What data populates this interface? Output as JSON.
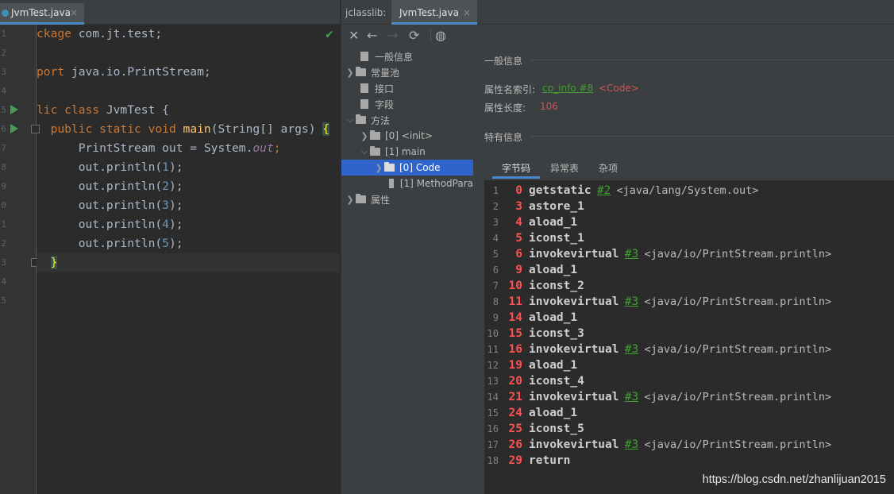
{
  "editor": {
    "tab": {
      "name": "JvmTest.java",
      "close": "×"
    },
    "line_numbers": [
      "1",
      "2",
      "3",
      "4",
      "5",
      "6",
      "7",
      "8",
      "9",
      "0",
      "1",
      "2",
      "3",
      "4",
      "5"
    ],
    "code": {
      "l1_a": "ckage",
      "l1_b": " com.jt.test;",
      "l3_a": "port",
      "l3_b": " java.io.PrintStream;",
      "l5_a": "lic",
      "l5_b": " class",
      "l5_c": " JvmTest {",
      "l6_indent": "  ",
      "l6_a": "public static void",
      "l6_b": " ",
      "l6_c": "main",
      "l6_d": "(String[] args) ",
      "l6_e": "{",
      "l7_a": "      PrintStream out = System.",
      "l7_b": "out",
      "l7_c": ";",
      "l8_a": "      out.println(",
      "l8_n": "1",
      "l8_c": ");",
      "l9_a": "      out.println(",
      "l9_n": "2",
      "l9_c": ");",
      "l10_a": "      out.println(",
      "l10_n": "3",
      "l10_c": ");",
      "l11_a": "      out.println(",
      "l11_n": "4",
      "l11_c": ");",
      "l12_a": "      out.println(",
      "l12_n": "5",
      "l12_c": ");",
      "l13_indent": "  ",
      "l13_a": "}"
    },
    "check_mark": "✔"
  },
  "panel": {
    "tab_label": "jclasslib:",
    "tab": {
      "name": "JvmTest.java",
      "close": "×"
    },
    "toolbar": {
      "close": "✕",
      "back": "←",
      "forward": "→",
      "refresh": "⟳",
      "browser": "◍"
    },
    "tree": [
      {
        "label": "一般信息"
      },
      {
        "label": "常量池"
      },
      {
        "label": "接口"
      },
      {
        "label": "字段"
      },
      {
        "label": "方法"
      },
      {
        "label": "[0] <init>"
      },
      {
        "label": "[1] main"
      },
      {
        "label": "[0] Code"
      },
      {
        "label": "[1] MethodPara"
      },
      {
        "label": "属性"
      }
    ],
    "detail": {
      "general_title": "一般信息",
      "name_index_label": "属性名索引:",
      "name_index_link": "cp_info #8",
      "name_index_value": "<Code>",
      "length_label": "属性长度:",
      "length_value": "106",
      "specific_title": "特有信息",
      "subtabs": [
        "字节码",
        "异常表",
        "杂项"
      ]
    },
    "bytecode": [
      {
        "no": "1",
        "off": "0",
        "op": "getstatic",
        "ref": "#2",
        "comment": "<java/lang/System.out>"
      },
      {
        "no": "2",
        "off": "3",
        "op": "astore_1",
        "ref": "",
        "comment": ""
      },
      {
        "no": "3",
        "off": "4",
        "op": "aload_1",
        "ref": "",
        "comment": ""
      },
      {
        "no": "4",
        "off": "5",
        "op": "iconst_1",
        "ref": "",
        "comment": ""
      },
      {
        "no": "5",
        "off": "6",
        "op": "invokevirtual",
        "ref": "#3",
        "comment": "<java/io/PrintStream.println>"
      },
      {
        "no": "6",
        "off": "9",
        "op": "aload_1",
        "ref": "",
        "comment": ""
      },
      {
        "no": "7",
        "off": "10",
        "op": "iconst_2",
        "ref": "",
        "comment": ""
      },
      {
        "no": "8",
        "off": "11",
        "op": "invokevirtual",
        "ref": "#3",
        "comment": "<java/io/PrintStream.println>"
      },
      {
        "no": "9",
        "off": "14",
        "op": "aload_1",
        "ref": "",
        "comment": ""
      },
      {
        "no": "10",
        "off": "15",
        "op": "iconst_3",
        "ref": "",
        "comment": ""
      },
      {
        "no": "11",
        "off": "16",
        "op": "invokevirtual",
        "ref": "#3",
        "comment": "<java/io/PrintStream.println>"
      },
      {
        "no": "12",
        "off": "19",
        "op": "aload_1",
        "ref": "",
        "comment": ""
      },
      {
        "no": "13",
        "off": "20",
        "op": "iconst_4",
        "ref": "",
        "comment": ""
      },
      {
        "no": "14",
        "off": "21",
        "op": "invokevirtual",
        "ref": "#3",
        "comment": "<java/io/PrintStream.println>"
      },
      {
        "no": "15",
        "off": "24",
        "op": "aload_1",
        "ref": "",
        "comment": ""
      },
      {
        "no": "16",
        "off": "25",
        "op": "iconst_5",
        "ref": "",
        "comment": ""
      },
      {
        "no": "17",
        "off": "26",
        "op": "invokevirtual",
        "ref": "#3",
        "comment": "<java/io/PrintStream.println>"
      },
      {
        "no": "18",
        "off": "29",
        "op": "return",
        "ref": "",
        "comment": ""
      }
    ]
  },
  "watermark": "https://blog.csdn.net/zhanlijuan2015"
}
